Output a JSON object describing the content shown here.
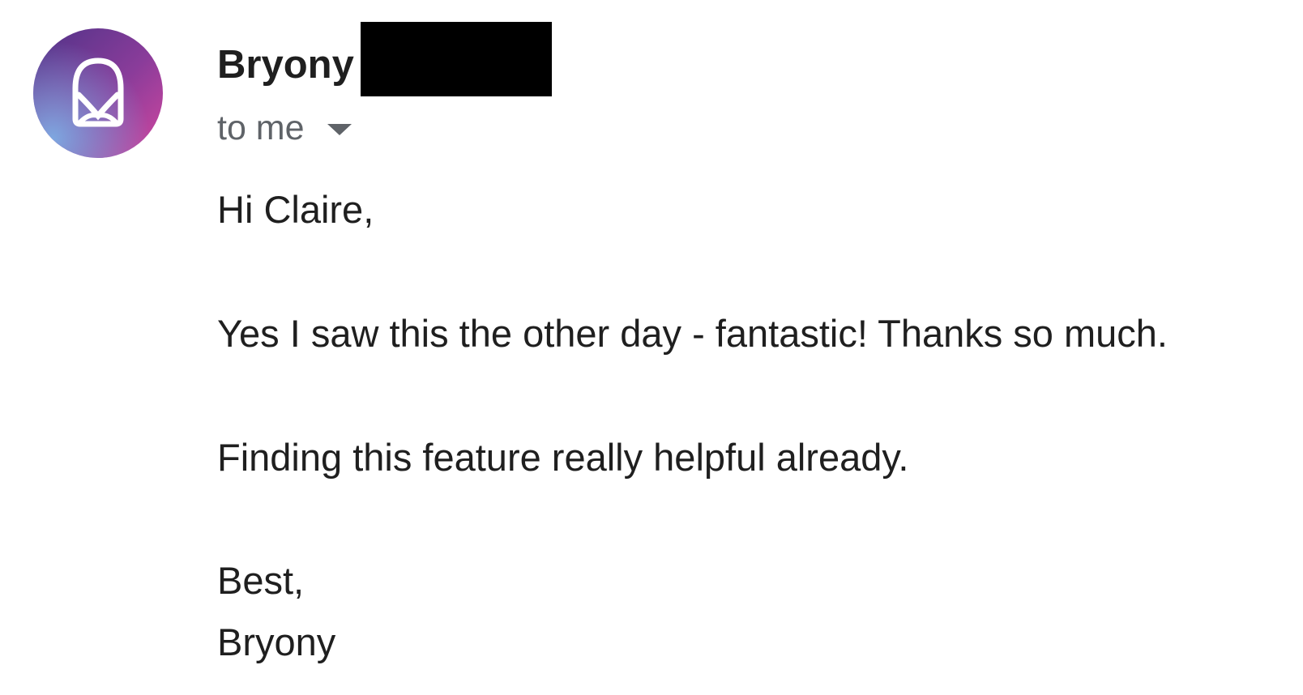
{
  "sender": {
    "name": "Bryony",
    "avatar_icon": "envelope-heart-logo-icon",
    "avatar_gradient": [
      "#5b3b8c",
      "#c0449a",
      "#7ea7e0"
    ]
  },
  "recipient": {
    "label": "to me",
    "dropdown_icon": "caret-down-icon"
  },
  "message": {
    "greeting": "Hi Claire,",
    "line1": "Yes I saw this the other day - fantastic! Thanks so much.",
    "line2": "Finding this feature really helpful already.",
    "signoff": "Best,",
    "signature": "Bryony"
  }
}
